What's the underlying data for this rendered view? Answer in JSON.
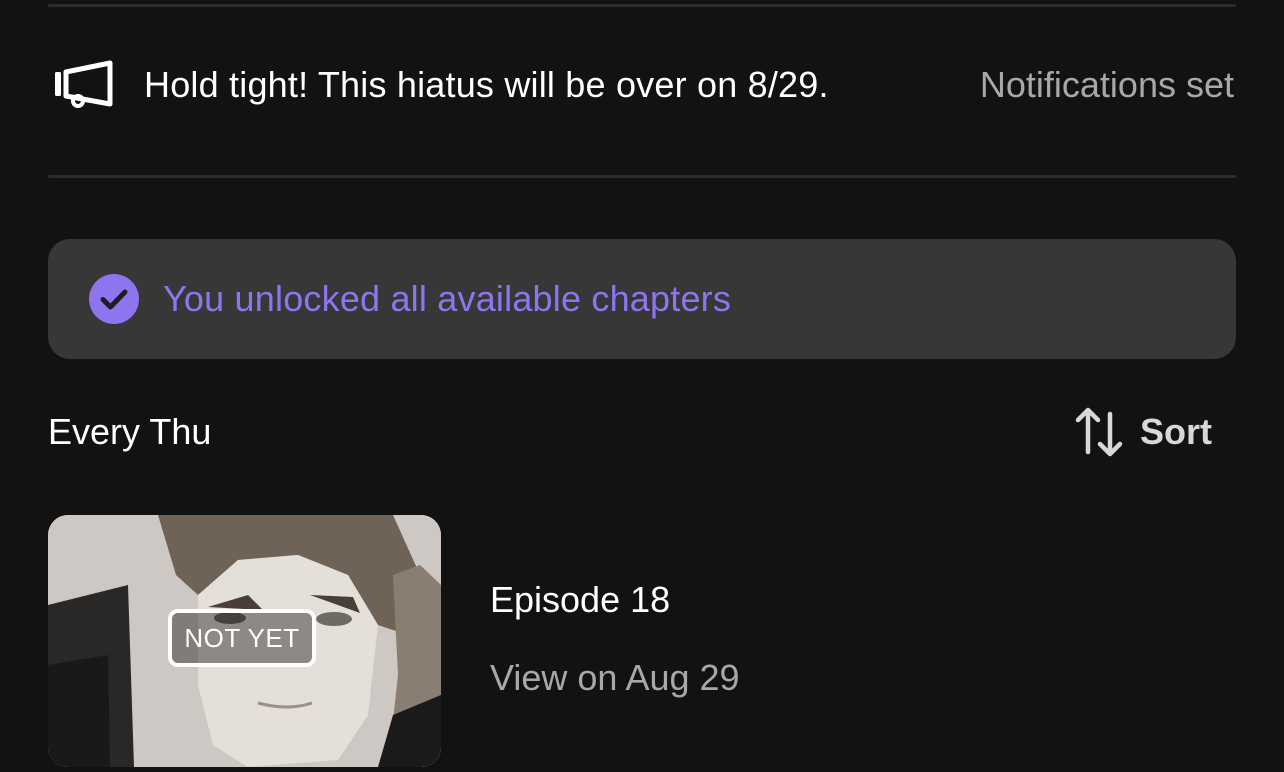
{
  "hiatus_notice": {
    "icon": "megaphone-icon",
    "message": "Hold tight! This hiatus will be over on 8/29.",
    "notification_status": "Notifications set"
  },
  "unlock_banner": {
    "icon": "check-circle-icon",
    "text": "You unlocked all available chapters",
    "accent_color": "#8f74f0"
  },
  "schedule": {
    "label": "Every Thu",
    "sort_icon": "sort-arrows-icon",
    "sort_label": "Sort"
  },
  "episodes": [
    {
      "badge": "NOT YET",
      "title": "Episode 18",
      "availability": "View on Aug 29"
    }
  ],
  "colors": {
    "background": "#121212",
    "banner": "#373737",
    "secondary_text": "#a8a8a8"
  }
}
